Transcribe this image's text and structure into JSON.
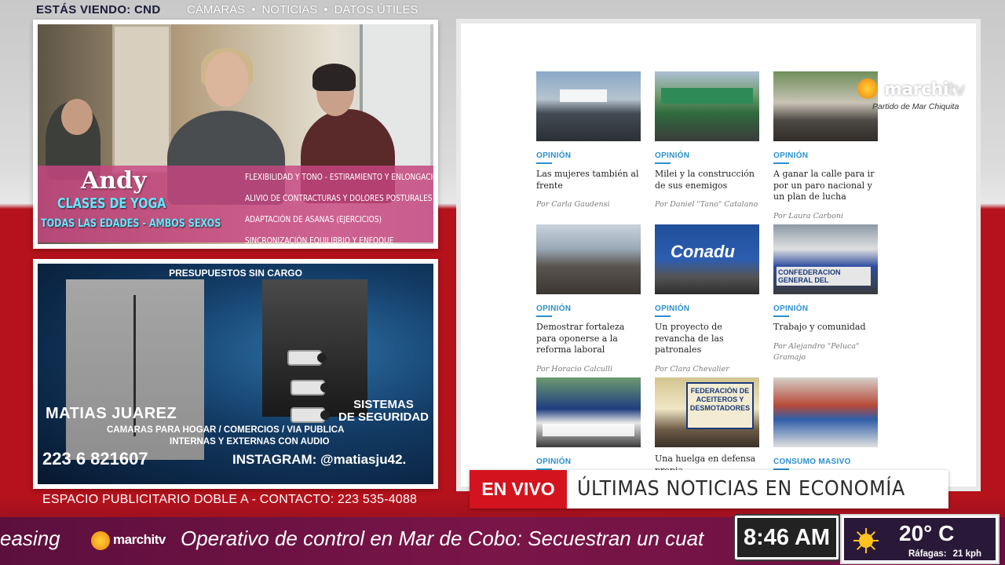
{
  "header": {
    "watching": "ESTÁS VIENDO: CND",
    "nav": [
      "CÁMARAS",
      "NOTICIAS",
      "DATOS ÚTILES"
    ],
    "separator": "•"
  },
  "ads": {
    "yoga": {
      "name": "Andy",
      "title": "CLASES DE YOGA",
      "subtitle": "TODAS LAS EDADES - AMBOS SEXOS",
      "benefits": [
        "FLEXIBILIDAD Y TONO - ESTIRAMIENTO Y ENLONGACIÓN",
        "ALIVIO DE CONTRACTURAS Y DOLORES POSTURALES",
        "ADAPTACIÓN DE ASANAS (EJERCICIOS)",
        "SINCRONIZACIÓN EQUILIBRIO Y ENFOQUE"
      ]
    },
    "security": {
      "top": "PRESUPUESTOS SIN CARGO",
      "name": "MATIAS JUAREZ",
      "systems_line1": "SISTEMAS",
      "systems_line2": "DE SEGURIDAD",
      "line1": "CAMARAS PARA HOGAR  / COMERCIOS / VIA PUBLICA",
      "line2": "INTERNAS Y EXTERNAS CON AUDIO",
      "phone": "223 6 821607",
      "instagram": "INSTAGRAM: @matiasju42."
    },
    "footer": "ESPACIO PUBLICITARIO DOBLE A - CONTACTO: 223 535-4088"
  },
  "news": {
    "cards": [
      {
        "category": "OPINIÓN",
        "headline": "Las mujeres también al frente",
        "author": "Por Carla Gaudensi"
      },
      {
        "category": "OPINIÓN",
        "headline": "Milei y la construcción de sus enemigos",
        "author": "Por Daniel \"Tano\" Catalano"
      },
      {
        "category": "OPINIÓN",
        "headline": "A ganar la calle para ir por un paro nacional y un plan de lucha",
        "author": "Por Laura Carboni"
      },
      {
        "category": "OPINIÓN",
        "headline": "Demostrar fortaleza para oponerse a la reforma laboral",
        "author": "Por Horacio Calculli"
      },
      {
        "category": "OPINIÓN",
        "headline": "Un proyecto de revancha de las patronales",
        "author": "Por Clara Chevalier"
      },
      {
        "category": "OPINIÓN",
        "headline": "Trabajo y comunidad",
        "author": "Por Alejandro \"Peluca\" Gramajo"
      },
      {
        "category": "OPINIÓN",
        "headline": "",
        "author": ""
      },
      {
        "category": "",
        "headline": "Una huelga en defensa propia",
        "author": ""
      },
      {
        "category": "CONSUMO MASIVO",
        "headline": "",
        "author": ""
      }
    ],
    "thumb_texts": {
      "conadu": "Conadu",
      "confederacion": "CONFEDERACION GENERAL DEL",
      "federacion": "FEDERACIÓN DE ACEITEROS Y DESMOTADORES"
    }
  },
  "logo": {
    "name_main": "marchi",
    "name_tv": "tv",
    "tagline": "Partido de Mar Chiquita"
  },
  "lower_third": {
    "live": "EN VIVO",
    "title": "ÚLTIMAS NOTICIAS EN ECONOMÍA"
  },
  "ticker": {
    "prev": "easing",
    "logo": "marchitv",
    "text": "Operativo de control en Mar de Cobo:  Secuestran un cuat"
  },
  "clock": "8:46 AM",
  "weather": {
    "temp": "20° C",
    "gusts_label": "Ráfagas:",
    "gusts_value": "21 kph",
    "icon": "sun-icon"
  },
  "colors": {
    "live_red": "#d3141e",
    "category_blue": "#2a8fcf",
    "ticker_bg": "#6a1040",
    "yoga_overlay": "#c84682",
    "yoga_title": "#66e5ff"
  }
}
